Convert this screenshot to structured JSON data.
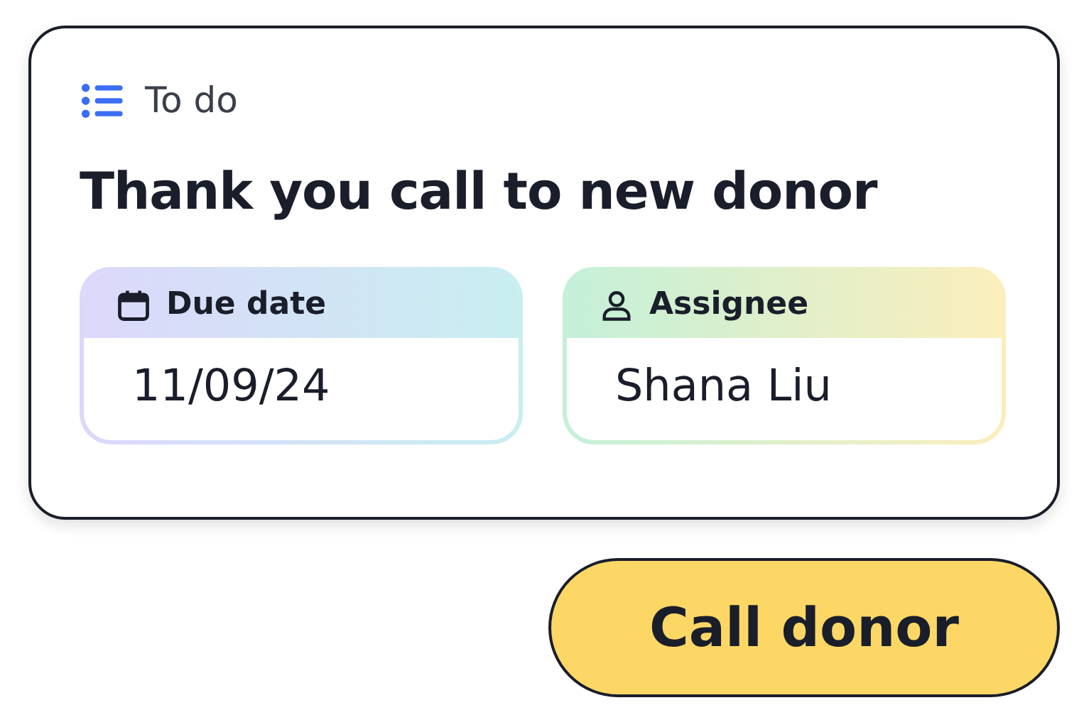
{
  "card": {
    "category": "To do",
    "title": "Thank you call to new donor",
    "fields": [
      {
        "kind": "date",
        "label": "Due date",
        "value": "11/09/24"
      },
      {
        "kind": "person",
        "label": "Assignee",
        "value": "Shana Liu"
      }
    ]
  },
  "buttons": [
    "Call donor"
  ]
}
